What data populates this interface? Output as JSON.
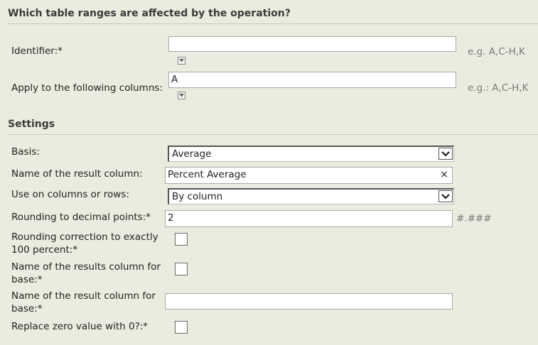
{
  "sections": {
    "ranges_title": "Which table ranges are affected by the operation?",
    "settings_title": "Settings"
  },
  "ranges": {
    "identifier_label": "Identifier:*",
    "identifier_value": "",
    "identifier_hint": "e.g. A,C-H,K",
    "columns_label": "Apply to the following columns:",
    "columns_value": "A",
    "columns_hint": "e.g.: A,C-H,K"
  },
  "settings": {
    "basis_label": "Basis:",
    "basis_value": "Average",
    "result_name_label": "Name of the result column:",
    "result_name_value": "Percent Average",
    "clear_glyph": "×",
    "orientation_label": "Use on columns or rows:",
    "orientation_value": "By column",
    "rounding_label": "Rounding to decimal points:*",
    "rounding_value": "2",
    "rounding_hint": "#.###",
    "correction_label_1": "Rounding correction to exactly",
    "correction_label_2": "100 percent:*",
    "correction_checked": false,
    "base_results_label_1": "Name of the results column for",
    "base_results_label_2": "base:*",
    "base_results_checked": false,
    "base_name_label_1": "Name of the result column for",
    "base_name_label_2": "base:*",
    "base_name_value": "",
    "zero_label": "Replace zero value with 0?:*",
    "zero_checked": false
  },
  "icons": {
    "dropdown": "chevron-down-icon",
    "mini_dropdown": "small-dropdown-icon",
    "clear": "close-icon"
  }
}
